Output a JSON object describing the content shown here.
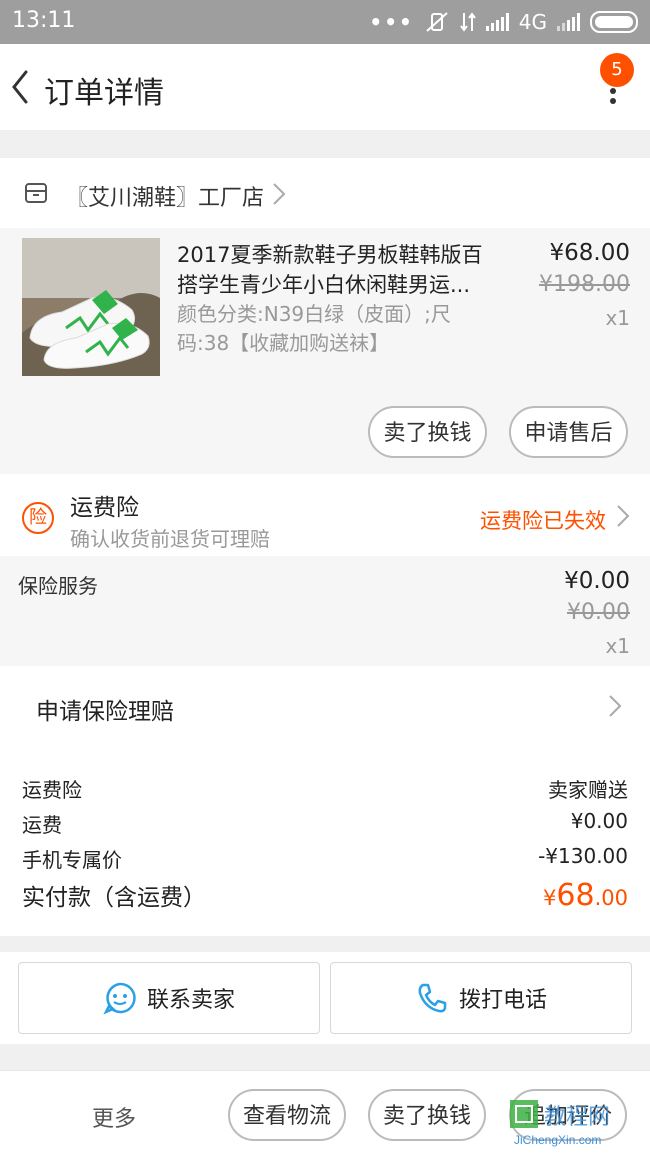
{
  "status_bar": {
    "time": "13:11",
    "network": "4G"
  },
  "header": {
    "title": "订单详情",
    "badge_count": "5"
  },
  "shop": {
    "name": "〖艾川潮鞋〗工厂店"
  },
  "product": {
    "title": "2017夏季新款鞋子男板鞋韩版百搭学生青少年小白休闲鞋男运...",
    "spec": "颜色分类:N39白绿（皮面）;尺码:38【收藏加购送袜】",
    "price": "¥68.00",
    "original_price": "¥198.00",
    "quantity": "x1",
    "actions": [
      "卖了换钱",
      "申请售后"
    ]
  },
  "insurance": {
    "title": "运费险",
    "subtitle": "确认收货前退货可理赔",
    "status": "运费险已失效",
    "icon_char": "险"
  },
  "insurance_service": {
    "label": "保险服务",
    "price": "¥0.00",
    "original_price": "¥0.00",
    "quantity": "x1"
  },
  "claim": {
    "label": "申请保险理赔"
  },
  "summary": {
    "rows": [
      {
        "label": "运费险",
        "value": "卖家赠送"
      },
      {
        "label": "运费",
        "value": "¥0.00"
      },
      {
        "label": "手机专属价",
        "value": "-¥130.00"
      }
    ],
    "total_label": "实付款（含运费）",
    "total_currency": "¥",
    "total_main": "68",
    "total_decimal": ".00"
  },
  "contact": {
    "seller": "联系卖家",
    "call": "拨打电话"
  },
  "bottom_bar": {
    "more": "更多",
    "buttons": [
      "查看物流",
      "卖了换钱",
      "追加评价"
    ]
  },
  "watermark": {
    "text": "JiChengXin.com"
  },
  "colors": {
    "accent": "#ff5000",
    "status_bar": "#9e9e9e",
    "contact_icon": "#2aa0e6"
  }
}
